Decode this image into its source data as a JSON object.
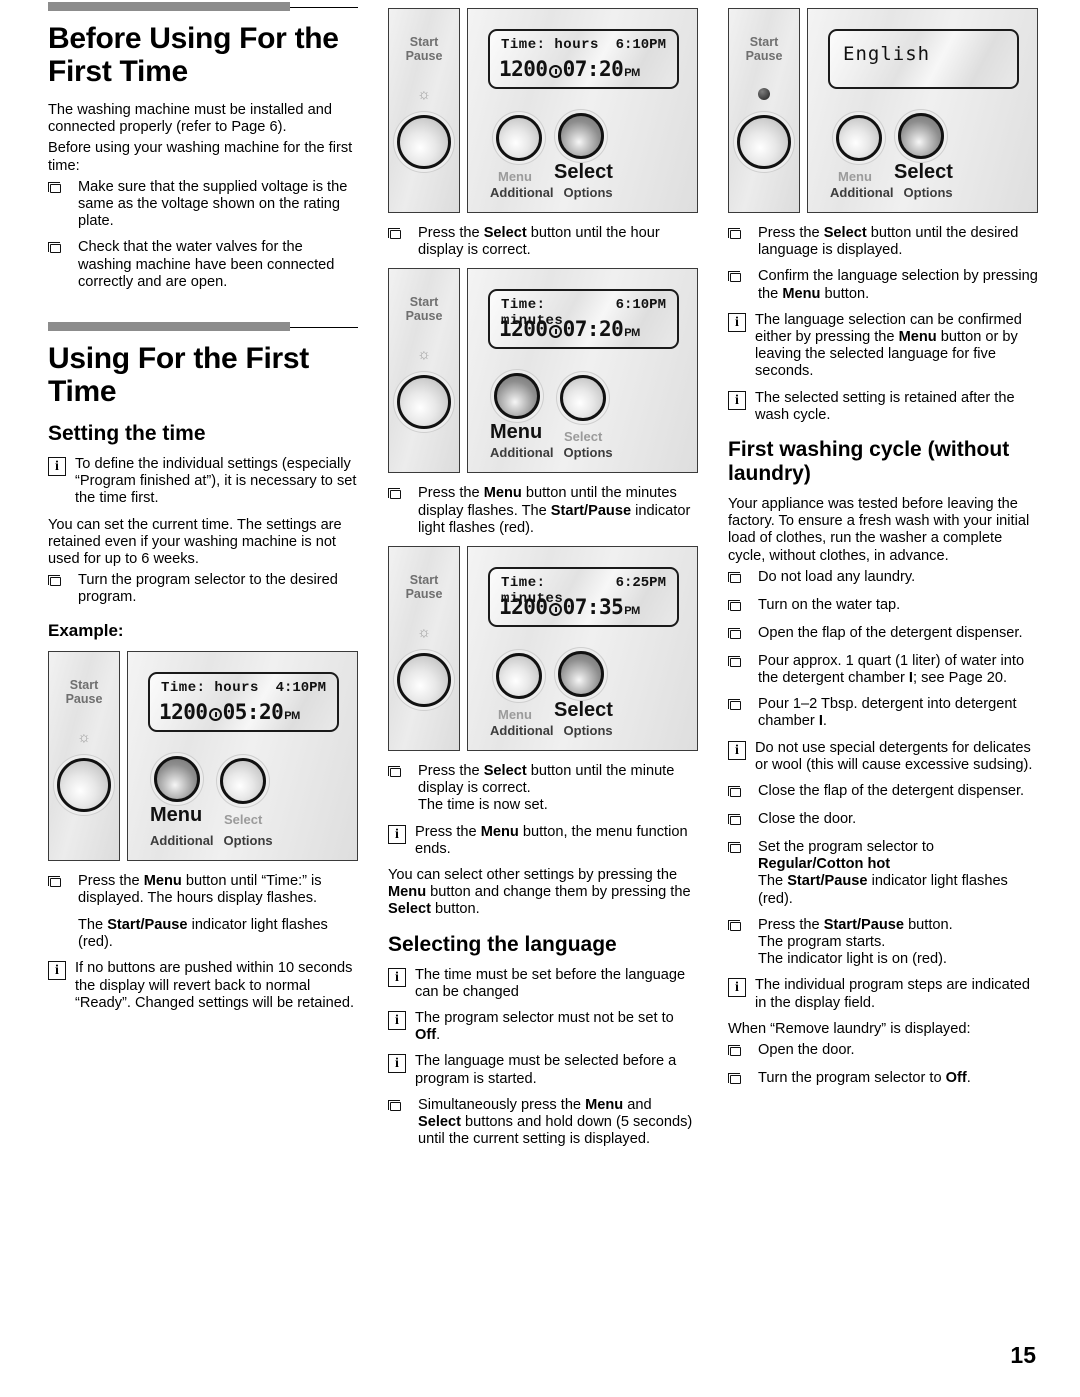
{
  "page_number": "15",
  "col1": {
    "heading1": "Before Using For the First Time",
    "intro1": "The washing machine must be installed and connected properly (refer to Page 6).",
    "intro2": "Before using your washing machine for the first time:",
    "bullets1": [
      "Make sure that the supplied voltage is the same as the voltage shown on the rating plate.",
      "Check that the water valves for the washing machine have been connected correctly and are open."
    ],
    "heading2": "Using For the First Time",
    "sub1": "Setting the time",
    "info1": "To define the individual settings (especially “Program finished at”), it is necessary to set the time first.",
    "para1": "You can set the current time. The settings are retained even if your washing machine is not used for up  to 6 weeks.",
    "bullet2": "Turn the program selector to the desired program.",
    "example_label": "Example:",
    "panel": {
      "start": "Start",
      "pause": "Pause",
      "lcd_line1_left": "Time: hours",
      "lcd_line1_right": "4:10PM",
      "lcd_prog": "1200",
      "lcd_time": "05:20",
      "lcd_pm": "PM",
      "menu": "Menu",
      "select": "Select",
      "additional": "Additional",
      "options": "Options"
    },
    "bullet3_a": "Press the ",
    "bullet3_menu": "Menu",
    "bullet3_b": " button until “Time:” is displayed. The hours display flashes.",
    "note_a": "The ",
    "note_sp": "Start/Pause",
    "note_b": " indicator light flashes (red).",
    "info2": "If no buttons are pushed within 10 seconds the display will revert back to normal “Ready”. Changed settings will be retained."
  },
  "col2": {
    "panel1": {
      "start": "Start",
      "pause": "Pause",
      "lcd_line1_left": "Time: hours",
      "lcd_line1_right": "6:10PM",
      "lcd_prog": "1200",
      "lcd_time": "07:20",
      "lcd_pm": "PM",
      "menu": "Menu",
      "select": "Select",
      "additional": "Additional",
      "options": "Options"
    },
    "step1_a": "Press the ",
    "step1_b": "Select",
    "step1_c": " button until the hour display is correct.",
    "panel2": {
      "start": "Start",
      "pause": "Pause",
      "lcd_line1_left": "Time: minutes",
      "lcd_line1_right": "6:10PM",
      "lcd_prog": "1200",
      "lcd_time": "07:20",
      "lcd_pm": "PM",
      "menu": "Menu",
      "select": "Select",
      "additional": "Additional",
      "options": "Options"
    },
    "step2_a": "Press the ",
    "step2_b": "Menu",
    "step2_c": " button until the minutes display flashes.",
    "step2_d": "The ",
    "step2_e": "Start/Pause",
    "step2_f": " indicator light flashes (red).",
    "panel3": {
      "start": "Start",
      "pause": "Pause",
      "lcd_line1_left": "Time: minutes",
      "lcd_line1_right": "6:25PM",
      "lcd_prog": "1200",
      "lcd_time": "07:35",
      "lcd_pm": "PM",
      "menu": "Menu",
      "select": "Select",
      "additional": "Additional",
      "options": "Options"
    },
    "step3_a": "Press the ",
    "step3_b": "Select",
    "step3_c": " button until the minute display is correct.",
    "step3_d": "The time is now set.",
    "info1_a": "Press the ",
    "info1_b": "Menu",
    "info1_c": " button, the menu function ends.",
    "para1_a": "You can select other settings by pressing the ",
    "para1_b": "Menu",
    "para1_c": " button and change them by pressing the ",
    "para1_d": "Select",
    "para1_e": " button.",
    "heading": "Selecting the language",
    "lang_info1": "The time must be set before the language can be changed",
    "lang_info2_a": "The program selector must not be set to ",
    "lang_info2_b": "Off",
    "lang_info2_c": ".",
    "lang_info3": "The language must be selected before a program is started.",
    "lang_step_a": "Simultaneously press the ",
    "lang_step_b": "Menu",
    "lang_step_c": " and ",
    "lang_step_d": "Select",
    "lang_step_e": " buttons and hold down (5 seconds) until the current setting is displayed."
  },
  "col3": {
    "panel1": {
      "start": "Start",
      "pause": "Pause",
      "lcd_lang": "English",
      "menu": "Menu",
      "select": "Select",
      "additional": "Additional",
      "options": "Options"
    },
    "step1_a": "Press the ",
    "step1_b": "Select",
    "step1_c": " button until the desired language is displayed.",
    "step2_a": "Confirm the language selection by pressing the ",
    "step2_b": "Menu",
    "step2_c": " button.",
    "info1_a": "The language selection can be confirmed either by pressing the ",
    "info1_b": "Menu",
    "info1_c": " button or by leaving the selected language for five seconds.",
    "info2": "The selected setting is retained after the wash cycle.",
    "heading": "First washing cycle (without laundry)",
    "para1": "Your appliance was tested before leaving the factory.  To ensure a fresh wash with your initial load of clothes, run the washer a complete cycle, without clothes, in advance.",
    "b1": "Do not load any laundry.",
    "b2": "Turn on the water tap.",
    "b3": "Open the flap of the detergent dispenser.",
    "b4_a": "Pour approx. 1 quart (1 liter) of water into the detergent chamber ",
    "b4_b": "I",
    "b4_c": "; see Page 20.",
    "b5_a": "Pour 1–2 Tbsp. detergent into detergent chamber ",
    "b5_b": "I",
    "b5_c": ".",
    "info3": "Do not use special detergents for delicates or wool (this will cause excessive sudsing).",
    "b6": "Close the flap of the detergent dispenser.",
    "b7": "Close the door.",
    "b8_a": "Set the program selector to ",
    "b8_b": "Regular/Cotton hot",
    "b8_c": "The ",
    "b8_d": "Start/Pause",
    "b8_e": " indicator light flashes (red).",
    "b9_a": "Press the ",
    "b9_b": "Start/Pause",
    "b9_c": " button.",
    "b9_d": "The program starts.",
    "b9_e": "The indicator light is on (red).",
    "info4": "The individual program steps are indicated in the display field.",
    "para2": "When “Remove laundry” is displayed:",
    "b10": "Open the door.",
    "b11_a": "Turn the program selector to ",
    "b11_b": "Off",
    "b11_c": "."
  }
}
